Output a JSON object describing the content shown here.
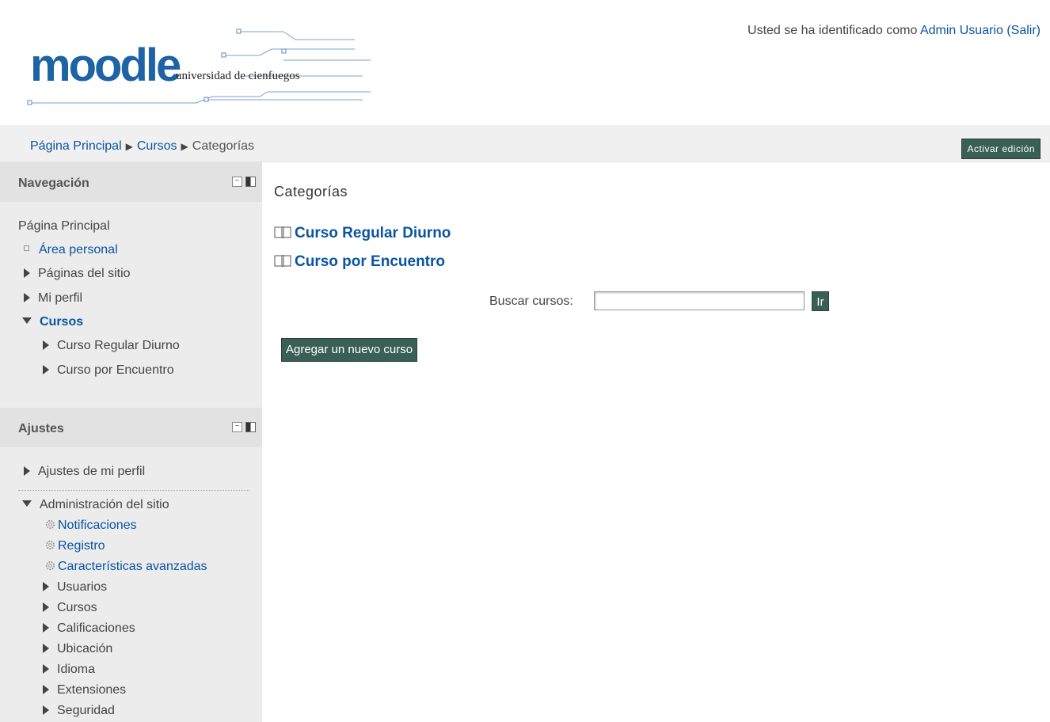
{
  "header": {
    "logo_word": "moodle",
    "logo_sub": "universidad de cienfuegos",
    "login_text": "Usted se ha identificado como",
    "login_user": "Admin Usuario",
    "login_logout": "(Salir)"
  },
  "breadcrumb": {
    "items": [
      "Página Principal",
      "Cursos",
      "Categorías"
    ],
    "separator": "▶"
  },
  "edit_button": "Activar edición",
  "navigation": {
    "title": "Navegación",
    "home": "Página Principal",
    "items": [
      {
        "label": "Área personal",
        "link": true
      },
      {
        "label": "Páginas del sitio",
        "link": false
      },
      {
        "label": "Mi perfil",
        "link": false
      },
      {
        "label": "Cursos",
        "link": true
      },
      {
        "label": "Curso Regular Diurno",
        "link": false
      },
      {
        "label": "Curso por Encuentro",
        "link": false
      }
    ]
  },
  "settings": {
    "title": "Ajustes",
    "items": [
      {
        "label": "Ajustes de mi perfil"
      },
      {
        "label": "Administración del sitio"
      },
      {
        "label": "Notificaciones"
      },
      {
        "label": "Registro"
      },
      {
        "label": "Características avanzadas"
      },
      {
        "label": "Usuarios"
      },
      {
        "label": "Cursos"
      },
      {
        "label": "Calificaciones"
      },
      {
        "label": "Ubicación"
      },
      {
        "label": "Idioma"
      },
      {
        "label": "Extensiones"
      },
      {
        "label": "Seguridad"
      }
    ]
  },
  "main": {
    "title": "Categorías",
    "categories": [
      "Curso Regular Diurno",
      "Curso por Encuentro"
    ],
    "search_label": "Buscar cursos:",
    "search_value": "",
    "go_label": "Ir",
    "add_button": "Agregar un nuevo curso"
  },
  "colors": {
    "link": "#0a54a3",
    "button_bg": "#3a5f57",
    "sidebar_bg": "#ececec"
  },
  "icons": {
    "block_collapse": "minus-box-icon",
    "block_dock": "dock-icon",
    "category": "book-icon",
    "admin_item": "gear-icon"
  }
}
